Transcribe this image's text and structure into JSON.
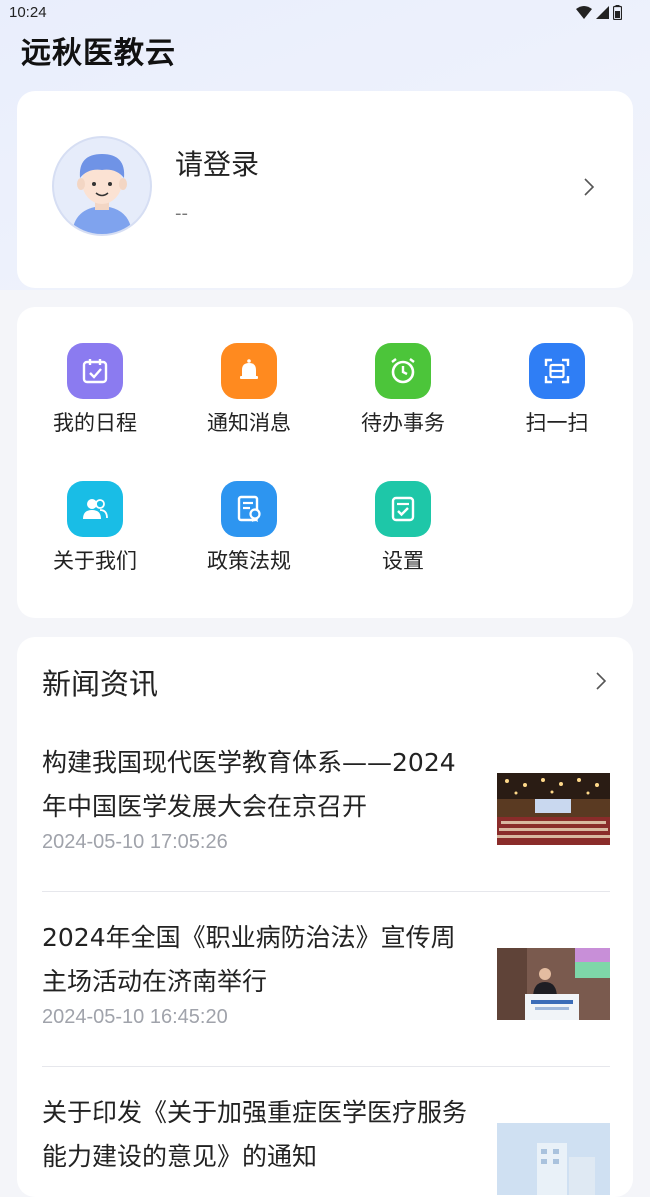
{
  "status_bar": {
    "time": "10:24"
  },
  "app": {
    "title": "远秋医教云"
  },
  "profile": {
    "login_prompt": "请登录",
    "subtitle": "--"
  },
  "menu": {
    "items": [
      {
        "label": "我的日程",
        "icon": "calendar-icon",
        "color": "#8b7bf0"
      },
      {
        "label": "通知消息",
        "icon": "bell-icon",
        "color": "#ff8a1f"
      },
      {
        "label": "待办事务",
        "icon": "alarm-clock-icon",
        "color": "#4cc53a"
      },
      {
        "label": "扫一扫",
        "icon": "scan-icon",
        "color": "#2f7ef5"
      },
      {
        "label": "关于我们",
        "icon": "people-icon",
        "color": "#19bde6"
      },
      {
        "label": "政策法规",
        "icon": "document-certificate-icon",
        "color": "#2d95f0"
      },
      {
        "label": "设置",
        "icon": "settings-edit-icon",
        "color": "#1ec7a8"
      }
    ]
  },
  "news": {
    "section_title": "新闻资讯",
    "items": [
      {
        "title": "构建我国现代医学教育体系——2024年中国医学发展大会在京召开",
        "date": "2024-05-10 17:05:26"
      },
      {
        "title": "2024年全国《职业病防治法》宣传周主场活动在济南举行",
        "date": "2024-05-10 16:45:20"
      },
      {
        "title": "关于印发《关于加强重症医学医疗服务能力建设的意见》的通知",
        "date": ""
      }
    ]
  }
}
